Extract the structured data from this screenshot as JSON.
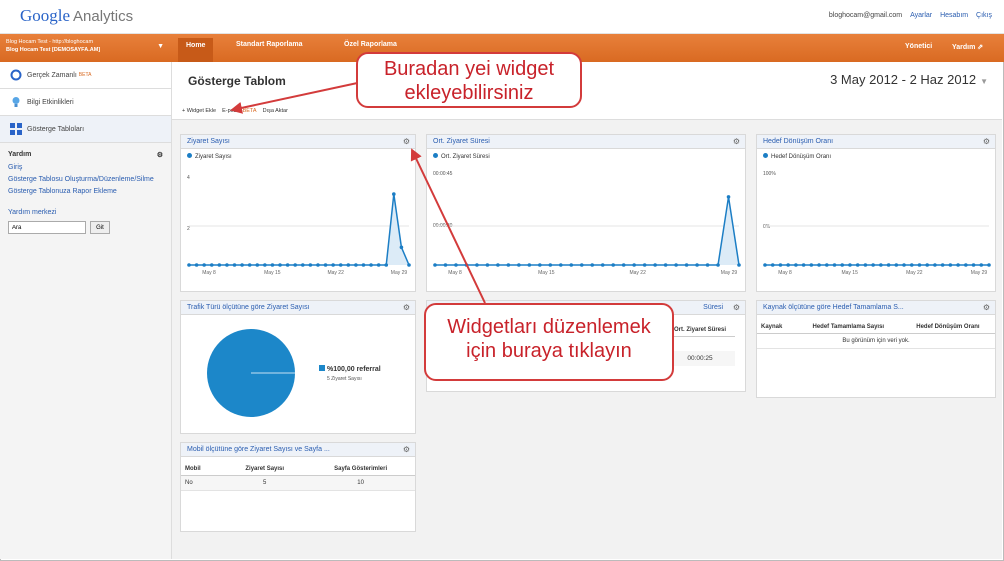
{
  "header": {
    "logo_word": "Google",
    "logo_product": "Analytics",
    "email": "bloghocam@gmail.com",
    "links": [
      "Ayarlar",
      "Hesabım",
      "Çıkış"
    ]
  },
  "nav": {
    "account_line1": "Blog Hocam Test - http://bloghocam",
    "account_line2": "Blog Hocam Test [DEMOSAYFA.AM]",
    "tabs": [
      "Home",
      "Standart Raporlama",
      "Özel Raporlama"
    ],
    "right": [
      "Yönetici",
      "Yardım ⇗"
    ]
  },
  "sidebar": {
    "items": [
      {
        "label": "Gerçek Zamanlı",
        "beta": "BETA"
      },
      {
        "label": "Bilgi Etkinlikleri",
        "beta": ""
      },
      {
        "label": "Gösterge Tabloları",
        "beta": ""
      }
    ],
    "help_title": "Yardım",
    "help_links": [
      "Giriş",
      "Gösterge Tablosu Oluşturma/Düzenleme/Silme",
      "Gösterge Tablonuza Rapor Ekleme"
    ],
    "help_center": "Yardım merkezi",
    "search_value": "Ara",
    "search_button": "Git"
  },
  "page": {
    "title": "Gösterge Tablom",
    "date_range": "3 May 2012 - 2 Haz 2012",
    "actions": {
      "add_widget": "+ Widget Ekle",
      "share": "E-posta",
      "share_beta": "BETA",
      "extra": "Dışa Aktar"
    }
  },
  "widgets": {
    "visits": {
      "title": "Ziyaret Sayısı",
      "legend": "Ziyaret Sayısı",
      "y_labels": [
        "4",
        "2"
      ]
    },
    "avg_duration": {
      "title": "Ort. Ziyaret Süresi",
      "legend": "Ort. Ziyaret Süresi",
      "y_labels": [
        "00:00:45",
        "00:00:30"
      ]
    },
    "goal_conversion": {
      "title": "Hedef Dönüşüm Oranı",
      "legend": "Hedef Dönüşüm Oranı",
      "y_labels": [
        "100%",
        "0%"
      ]
    },
    "traffic_type": {
      "title": "Trafik Türü ölçütüne göre Ziyaret Sayısı",
      "legend_pct": "%100,00 referral",
      "legend_sub": "5 Ziyaret Sayısı"
    },
    "duration_table": {
      "title": "Süresi",
      "col": "Ort. Ziyaret Süresi",
      "value": "00:00:25"
    },
    "source_goal": {
      "title": "Kaynak ölçütüne göre Hedef Tamamlama S...",
      "cols": [
        "Kaynak",
        "Hedef Tamamlama Sayısı",
        "Hedef Dönüşüm Oranı"
      ],
      "empty": "Bu görünüm için veri yok."
    },
    "mobile": {
      "title": "Mobil ölçütüne göre Ziyaret Sayısı ve Sayfa ...",
      "cols": [
        "Mobil",
        "Ziyaret Sayısı",
        "Sayfa Gösterimleri"
      ],
      "row": [
        "No",
        "5",
        "10"
      ]
    }
  },
  "annotations": {
    "top_l1": "Buradan yei widget",
    "top_l2": "ekleyebilirsiniz",
    "mid_l1": "Widgetları düzenlemek",
    "mid_l2": "için buraya tıklayın"
  },
  "chart_data": [
    {
      "type": "line",
      "title": "Ziyaret Sayısı",
      "categories": [
        "May 8",
        "May 15",
        "May 22",
        "May 29"
      ],
      "series": [
        {
          "name": "Ziyaret Sayısı",
          "values": [
            0,
            0,
            0,
            0,
            0,
            0,
            0,
            0,
            0,
            0,
            0,
            0,
            0,
            0,
            0,
            0,
            0,
            0,
            0,
            0,
            0,
            0,
            0,
            0,
            0,
            0,
            0,
            4,
            1,
            0
          ]
        }
      ],
      "ylim": [
        0,
        4.4
      ]
    },
    {
      "type": "line",
      "title": "Ort. Ziyaret Süresi",
      "categories": [
        "May 8",
        "May 15",
        "May 22",
        "May 29"
      ],
      "series": [
        {
          "name": "Ort. Ziyaret Süresi",
          "values": [
            0,
            0,
            0,
            0,
            0,
            0,
            0,
            0,
            0,
            0,
            0,
            0,
            0,
            0,
            0,
            0,
            0,
            0,
            0,
            0,
            0,
            0,
            0,
            0,
            0,
            0,
            0,
            0,
            48,
            0
          ]
        }
      ],
      "ylim": [
        0,
        55
      ]
    },
    {
      "type": "line",
      "title": "Hedef Dönüşüm Oranı",
      "categories": [
        "May 8",
        "May 15",
        "May 22",
        "May 29"
      ],
      "series": [
        {
          "name": "Hedef Dönüşüm Oranı",
          "values": [
            0,
            0,
            0,
            0,
            0,
            0,
            0,
            0,
            0,
            0,
            0,
            0,
            0,
            0,
            0,
            0,
            0,
            0,
            0,
            0,
            0,
            0,
            0,
            0,
            0,
            0,
            0,
            0,
            0,
            0
          ]
        }
      ],
      "ylim": [
        0,
        100
      ]
    },
    {
      "type": "pie",
      "title": "Trafik Türü ölçütüne göre Ziyaret Sayısı",
      "categories": [
        "referral"
      ],
      "values": [
        100
      ],
      "colors": [
        "#1c87c9"
      ]
    }
  ]
}
